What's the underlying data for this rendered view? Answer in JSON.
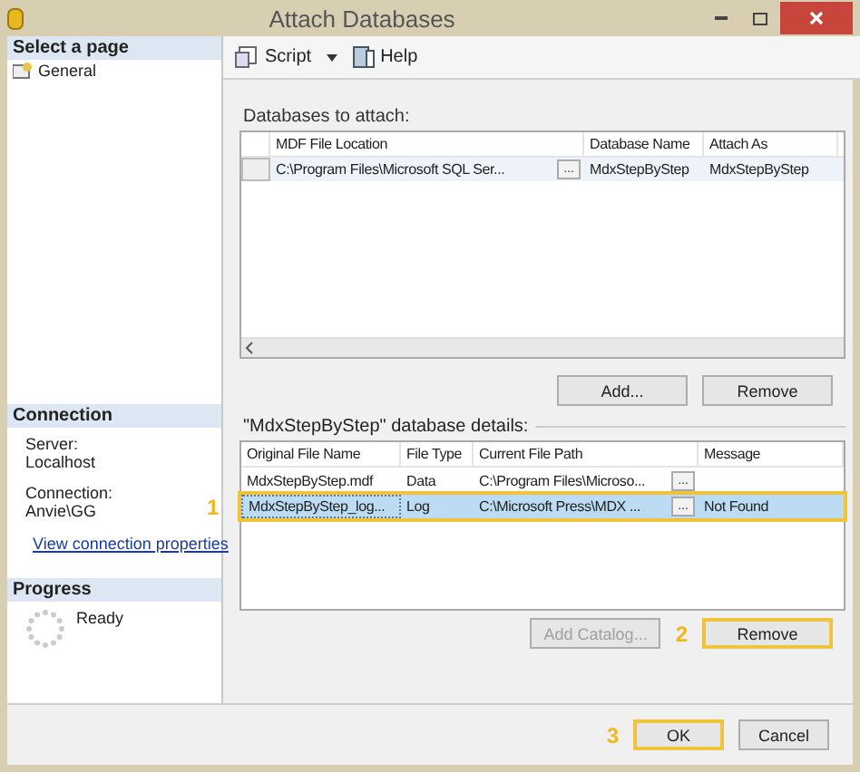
{
  "window": {
    "title": "Attach Databases"
  },
  "sidebar": {
    "select_header": "Select a page",
    "pages": [
      {
        "label": "General",
        "selected": false
      }
    ],
    "connection_header": "Connection",
    "connection": [
      {
        "label": "Server:",
        "value": "Localhost"
      },
      {
        "label": "Connection:",
        "value": "Anvie\\GG"
      }
    ],
    "link": "View connection properties",
    "progress_header": "Progress",
    "progress_status": "Ready"
  },
  "toolbar": [
    {
      "kind": "script",
      "label": "Script"
    },
    {
      "kind": "help",
      "label": "Help"
    }
  ],
  "attach": {
    "label": "Databases to attach:",
    "columns": [
      "MDF File Location",
      "Database Name",
      "Attach As"
    ],
    "rows": [
      {
        "location": "C:\\Program Files\\Microsoft SQL Ser...",
        "browse": "...",
        "database_name": "MdxStepByStep",
        "attach_as": "MdxStepByStep"
      }
    ],
    "buttons": [
      {
        "label": "Add...",
        "disabled": false
      },
      {
        "label": "Remove",
        "disabled": false
      }
    ]
  },
  "details": {
    "label": "\"MdxStepByStep\" database details:",
    "columns": [
      "Original File Name",
      "File Type",
      "Current File Path",
      "Message"
    ],
    "rows": [
      {
        "name": "MdxStepByStep.mdf",
        "type": "Data",
        "path": "C:\\Program Files\\Microso...",
        "browse": "...",
        "message": "",
        "selected": false
      },
      {
        "name": "MdxStepByStep_log...",
        "type": "Log",
        "path": "C:\\Microsoft Press\\MDX ...",
        "browse": "...",
        "message": "Not Found",
        "selected": true,
        "callout": "1"
      }
    ],
    "buttons": [
      {
        "label": "Add Catalog...",
        "disabled": true
      },
      {
        "label": "Remove",
        "disabled": false,
        "callout": "2"
      }
    ]
  },
  "footer_buttons": [
    {
      "label": "OK",
      "callout": "3"
    },
    {
      "label": "Cancel"
    }
  ]
}
